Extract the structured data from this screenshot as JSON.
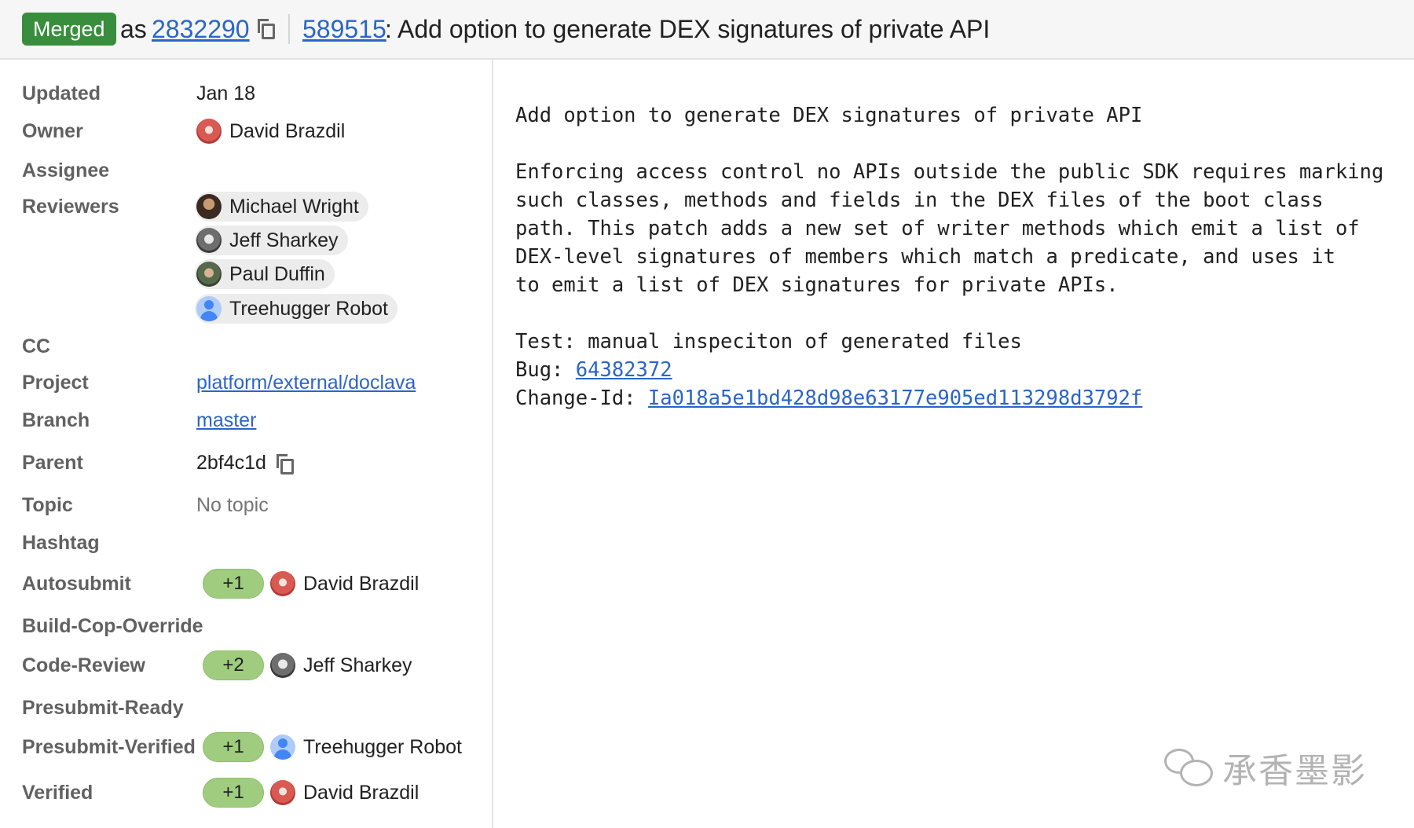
{
  "header": {
    "status": "Merged",
    "as_text": "as",
    "commit": "2832290",
    "change_number": "589515",
    "title_text": ": Add option to generate DEX signatures of private API"
  },
  "meta": {
    "updated": {
      "label": "Updated",
      "value": "Jan 18"
    },
    "owner": {
      "label": "Owner",
      "name": "David Brazdil"
    },
    "assignee": {
      "label": "Assignee"
    },
    "reviewers": {
      "label": "Reviewers",
      "items": [
        {
          "name": "Michael Wright",
          "avatar": "michael"
        },
        {
          "name": "Jeff Sharkey",
          "avatar": "jeff"
        },
        {
          "name": "Paul Duffin",
          "avatar": "paul"
        },
        {
          "name": "Treehugger Robot",
          "avatar": "robot"
        }
      ]
    },
    "cc": {
      "label": "CC"
    },
    "project": {
      "label": "Project",
      "value": "platform/external/doclava"
    },
    "branch": {
      "label": "Branch",
      "value": "master"
    },
    "parent": {
      "label": "Parent",
      "value": "2bf4c1d"
    },
    "topic": {
      "label": "Topic",
      "value": "No topic"
    },
    "hashtag": {
      "label": "Hashtag"
    }
  },
  "labels": {
    "autosubmit": {
      "label": "Autosubmit",
      "vote": "+1",
      "name": "David Brazdil"
    },
    "build_cop_override": {
      "label": "Build-Cop-Override"
    },
    "code_review": {
      "label": "Code-Review",
      "vote": "+2",
      "name": "Jeff Sharkey"
    },
    "presubmit_ready": {
      "label": "Presubmit-Ready"
    },
    "presubmit_verified": {
      "label": "Presubmit-Verified",
      "vote": "+1",
      "name": "Treehugger Robot"
    },
    "verified": {
      "label": "Verified",
      "vote": "+1",
      "name": "David Brazdil"
    }
  },
  "message": {
    "subject": "Add option to generate DEX signatures of private API",
    "body_lines": [
      "Enforcing access control no APIs outside the public SDK requires marking",
      "such classes, methods and fields in the DEX files of the boot class",
      "path. This patch adds a new set of writer methods which emit a list of",
      "DEX-level signatures of members which match a predicate, and uses it",
      "to emit a list of DEX signatures for private APIs."
    ],
    "test_line": "Test: manual inspeciton of generated files",
    "bug_label": "Bug: ",
    "bug_value": "64382372",
    "change_id_label": "Change-Id: ",
    "change_id_value": "Ia018a5e1bd428d98e63177e905ed113298d3792f"
  },
  "watermark": {
    "text": "承香墨影"
  },
  "colors": {
    "merged_chip": "#388e3c",
    "link": "#2a66c5",
    "vote_positive": "#9fcc7e",
    "header_bg": "#f6f6f6"
  },
  "icons": [
    "copy-icon",
    "avatar",
    "wechat-icon"
  ]
}
